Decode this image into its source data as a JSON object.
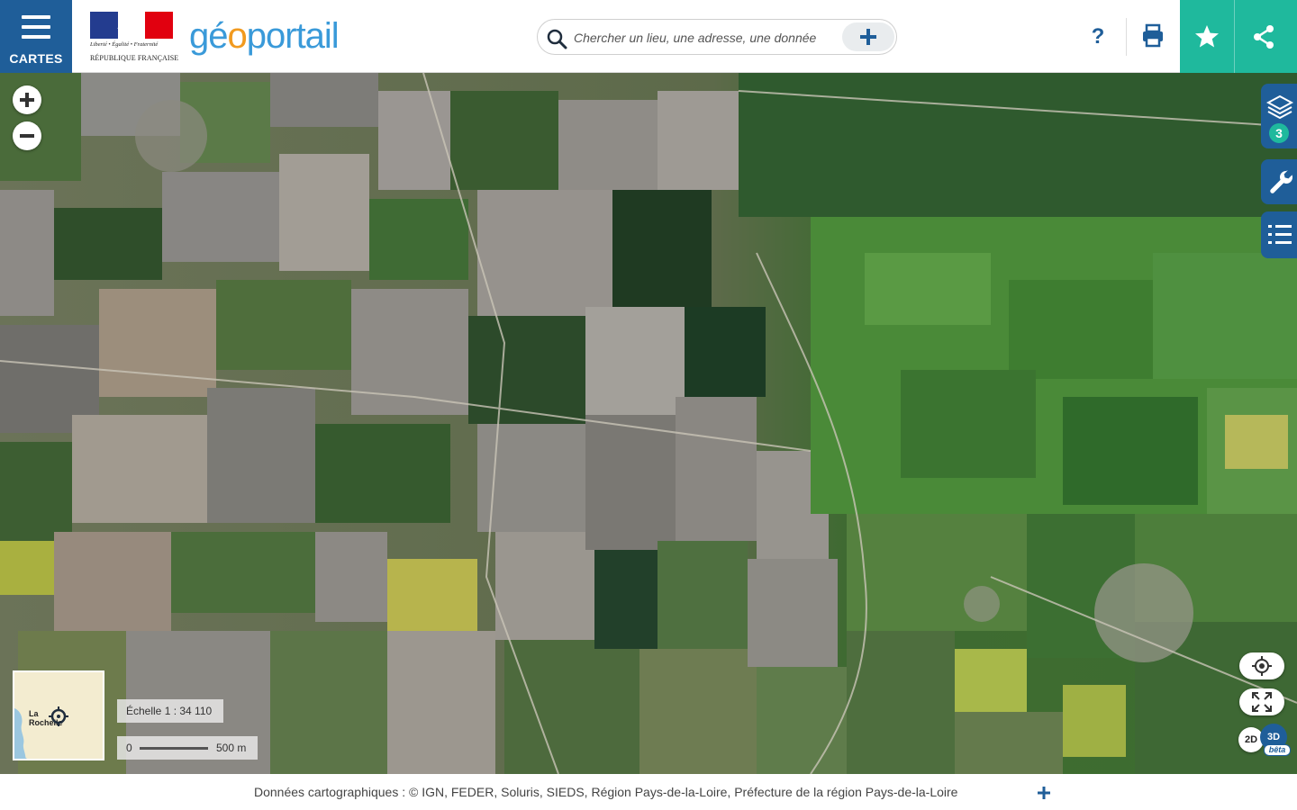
{
  "header": {
    "menu_label": "CARTES",
    "motto": "Liberté • Égalité • Fraternité",
    "republic": "RÉPUBLIQUE FRANÇAISE",
    "logo_part1": "gé",
    "logo_part2": "o",
    "logo_part3": "portail",
    "help_label": "?",
    "search": {
      "placeholder": "Chercher un lieu, une adresse, une donnée",
      "value": ""
    }
  },
  "map": {
    "layers_count": "3",
    "overview_town": "La\nRochelle",
    "scale_label": "Échelle 1 : 34 110",
    "scale_zero": "0",
    "scale_distance": "500 m",
    "mode_2d": "2D",
    "mode_3d": "3D",
    "mode_beta": "bêta"
  },
  "footer": {
    "credits": "Données cartographiques : ©  IGN,  FEDER,  Soluris,  SIEDS,  Région Pays-de-la-Loire,  Préfecture de la région Pays-de-la-Loire"
  },
  "colors": {
    "primary": "#1f5e99",
    "accent": "#1fb99d",
    "logo_blue": "#3a9ad9",
    "logo_orange": "#f19a1f"
  },
  "icons": [
    "menu-icon",
    "search-icon",
    "plus-icon",
    "help-icon",
    "print-icon",
    "star-icon",
    "share-icon",
    "zoom-in-icon",
    "zoom-out-icon",
    "layers-icon",
    "wrench-icon",
    "legend-list-icon",
    "geolocate-icon",
    "fullscreen-icon",
    "target-icon"
  ]
}
